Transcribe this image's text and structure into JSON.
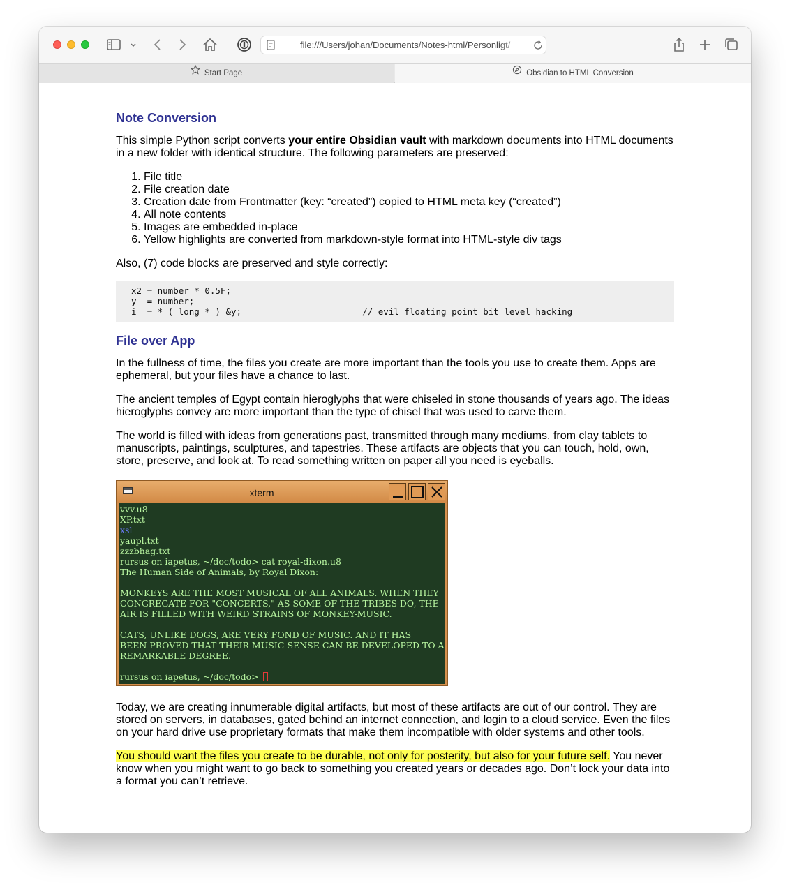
{
  "browser": {
    "url": "file:///Users/johan/Documents/Notes-html/Personligt/",
    "tabs": [
      {
        "label": "Start Page",
        "active": false
      },
      {
        "label": "Obsidian to HTML Conversion",
        "active": true
      }
    ]
  },
  "article": {
    "section1": {
      "heading": "Note Conversion",
      "intro_before": "This simple Python script converts ",
      "intro_bold": "your entire Obsidian vault",
      "intro_after": " with markdown documents into HTML documents in a new folder with identical structure. The following parameters are preserved:",
      "list": [
        "File title",
        "File creation date",
        "Creation date from Frontmatter (key: “created”) copied to HTML meta key (“created”)",
        "All note contents",
        "Images are embedded in-place",
        "Yellow highlights are converted from markdown-style format into HTML-style div tags"
      ],
      "after_list": "Also, (7) code blocks are preserved and style correctly:",
      "code_lines": [
        "x2 = number * 0.5F;",
        "y  = number;",
        "i  = * ( long * ) &y;                       // evil floating point bit level hacking"
      ]
    },
    "section2": {
      "heading": "File over App",
      "paragraphs": [
        "In the fullness of time, the files you create are more important than the tools you use to create them. Apps are ephemeral, but your files have a chance to last.",
        "The ancient temples of Egypt contain hieroglyphs that were chiseled in stone thousands of years ago. The ideas hieroglyphs convey are more important than the type of chisel that was used to carve them.",
        "The world is filled with ideas from generations past, transmitted through many mediums, from clay tablets to manuscripts, paintings, sculptures, and tapestries. These artifacts are objects that you can touch, hold, own, store, preserve, and look at. To read something written on paper all you need is eyeballs."
      ],
      "paragraph_after_image": "Today, we are creating innumerable digital artifacts, but most of these artifacts are out of our control. They are stored on servers, in databases, gated behind an internet connection, and login to a cloud service. Even the files on your hard drive use proprietary formats that make them incompatible with older systems and other tools.",
      "final_highlight": "You should want the files you create to be durable, not only for posterity, but also for your future self.",
      "final_rest": " You never know when you might want to go back to something you created years or decades ago. Don’t lock your data into a format you can’t retrieve."
    }
  },
  "xterm": {
    "title": "xterm",
    "lines": [
      "vvv.u8",
      "XP.txt",
      "xsl",
      "yaupl.txt",
      "zzzbhag.txt",
      "rursus on iapetus, ~/doc/todo> cat royal-dixon.u8",
      "The Human Side of Animals, by Royal Dixon:",
      "",
      "MONKEYS ARE THE MOST MUSICAL OF ALL ANIMALS. WHEN THEY",
      "CONGREGATE FOR \"CONCERTS,\" AS SOME OF THE TRIBES DO, THE",
      "AIR IS FILLED WITH WEIRD STRAINS OF MONKEY-MUSIC.",
      "",
      "CATS, UNLIKE DOGS, ARE VERY FOND OF MUSIC. AND IT HAS",
      "BEEN PROVED THAT THEIR MUSIC-SENSE CAN BE DEVELOPED TO A",
      "REMARKABLE DEGREE.",
      ""
    ],
    "prompt": "rursus on iapetus, ~/doc/todo> "
  },
  "icons": [
    "sidebar-icon",
    "chevron-down-icon",
    "back-icon",
    "forward-icon",
    "home-icon",
    "password-icon",
    "page-icon",
    "reload-icon",
    "share-icon",
    "new-tab-icon",
    "tab-overview-icon",
    "star-icon",
    "compass-icon"
  ],
  "colors": {
    "heading": "#2e3192",
    "highlight": "#ffff54",
    "xterm_bg": "#1f3b22",
    "xterm_text": "#b8f5a0",
    "xterm_frame": "#d5904e"
  }
}
